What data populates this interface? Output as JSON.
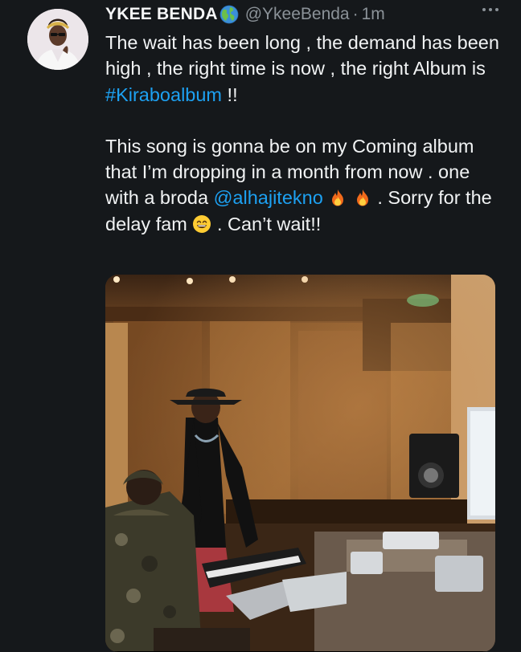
{
  "tweet": {
    "display_name": "YKEE BENDA",
    "handle": "@YkeeBenda",
    "separator": "·",
    "time": "1m",
    "verified_icon": "globe-icon",
    "more_icon": "more-horizontal-icon",
    "text": {
      "p1_part1": "The wait has been long , the demand has been high , the right time is now , the right Album is ",
      "hashtag": "#Kiraboalbum",
      "p1_part2": " !!",
      "p2_part1": "This song is gonna be on my Coming album that I’m dropping in a month from now . one with a broda ",
      "mention": "@alhajitekno",
      "p2_part2": " . Sorry for the delay fam ",
      "p2_part3": " . Can’t wait!!"
    },
    "media": {
      "icon": "photo-studio-image"
    }
  },
  "colors": {
    "background": "#15181b",
    "link": "#1da1f2",
    "secondary_text": "#8b9298"
  }
}
